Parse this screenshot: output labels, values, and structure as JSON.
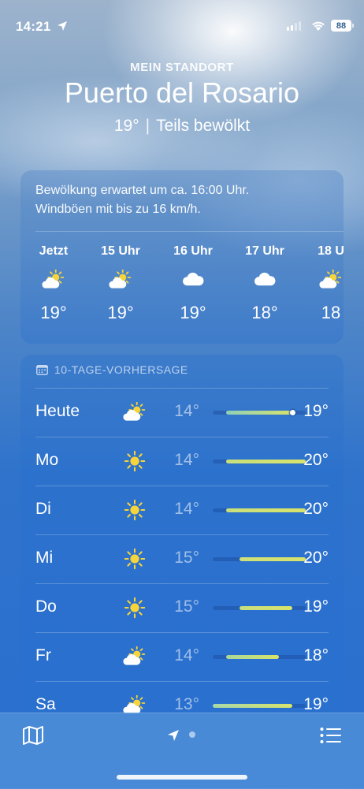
{
  "status": {
    "time": "14:21",
    "battery": "88"
  },
  "header": {
    "location_label": "MEIN STANDORT",
    "city": "Puerto del Rosario",
    "current_temp": "19°",
    "separator": "|",
    "condition": "Teils bewölkt"
  },
  "hourly": {
    "summary_line1": "Bewölkung erwartet um ca. 16:00 Uhr.",
    "summary_line2": "Windböen mit bis zu 16 km/h.",
    "items": [
      {
        "label": "Jetzt",
        "icon": "partly-cloudy-icon",
        "temp": "19°"
      },
      {
        "label": "15 Uhr",
        "icon": "partly-cloudy-icon",
        "temp": "19°"
      },
      {
        "label": "16 Uhr",
        "icon": "cloud-icon",
        "temp": "19°"
      },
      {
        "label": "17 Uhr",
        "icon": "cloud-icon",
        "temp": "18°"
      },
      {
        "label": "18 U",
        "icon": "partly-cloudy-icon",
        "temp": "18"
      }
    ]
  },
  "daily": {
    "title": "10-TAGE-VORHERSAGE",
    "icon": "calendar-icon",
    "range_min": 13,
    "range_max": 20,
    "days": [
      {
        "day": "Heute",
        "icon": "partly-cloudy-icon",
        "low": "14°",
        "high": "19°",
        "lo_val": 14,
        "hi_val": 19,
        "current": 19,
        "fill_color": "#8fd0b8"
      },
      {
        "day": "Mo",
        "icon": "sun-icon",
        "low": "14°",
        "high": "20°",
        "lo_val": 14,
        "hi_val": 20,
        "fill_color": "#c9df7a"
      },
      {
        "day": "Di",
        "icon": "sun-icon",
        "low": "14°",
        "high": "20°",
        "lo_val": 14,
        "hi_val": 20,
        "fill_color": "#c9df7a"
      },
      {
        "day": "Mi",
        "icon": "sun-icon",
        "low": "15°",
        "high": "20°",
        "lo_val": 15,
        "hi_val": 20,
        "fill_color": "#cfe07a"
      },
      {
        "day": "Do",
        "icon": "sun-icon",
        "low": "15°",
        "high": "19°",
        "lo_val": 15,
        "hi_val": 19,
        "fill_color": "#c5de80"
      },
      {
        "day": "Fr",
        "icon": "partly-cloudy-icon",
        "low": "14°",
        "high": "18°",
        "lo_val": 14,
        "hi_val": 18,
        "fill_color": "#a8d89a"
      },
      {
        "day": "Sa",
        "icon": "partly-cloudy-icon",
        "low": "13°",
        "high": "19°",
        "lo_val": 13,
        "hi_val": 19,
        "fill_color": "#a8d8a8"
      }
    ]
  },
  "colors": {
    "sun": "#f7d43a",
    "cloud": "#ffffff",
    "accent_bar": "#d8e36a"
  },
  "tabbar": {
    "map_icon": "map-icon",
    "location_icon": "location-arrow-icon",
    "list_icon": "list-icon"
  }
}
